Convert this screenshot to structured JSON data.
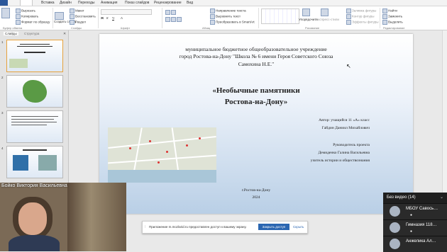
{
  "ribbon_tabs": [
    "Вставка",
    "Дизайн",
    "Переходы",
    "Анимация",
    "Показ слайдов",
    "Рецензирование",
    "Вид"
  ],
  "ribbon": {
    "cut": "Вырезать",
    "copy": "Копировать",
    "format_painter": "Формат по образцу",
    "layout": "Макет",
    "reset": "Восстановить",
    "section": "Раздел",
    "create_slide": "Создать слайд",
    "text_direction": "Направление текста",
    "align_text": "Выровнять текст",
    "smartart": "Преобразовать в SmartArt",
    "arrange": "Упорядочить",
    "quick_styles": "Экспресс-стили",
    "shape_fill": "Заливка фигуры",
    "shape_outline": "Контур фигуры",
    "shape_effects": "Эффекты фигуры",
    "find": "Найти",
    "replace": "Заменить",
    "select": "Выделить",
    "group_clipboard": "Буфер обмена",
    "group_slides": "Слайды",
    "group_font": "Шрифт",
    "group_paragraph": "Абзац",
    "group_drawing": "Рисование",
    "group_editing": "Редактирование"
  },
  "panel": {
    "tab_slides": "Слайды",
    "tab_outline": "Структура",
    "slide_numbers": [
      "1",
      "2",
      "3",
      "4"
    ]
  },
  "slide": {
    "org_line1": "муниципальное  бюджетное общеобразовательное учреждение",
    "org_line2": "город Ростова-на-Дону \"Школа  № 6 имени Героя Советского Союза",
    "org_line3": "Самохина Н.Е.\"",
    "title_line1": "«Необычные памятники",
    "title_line2": "Ростова-на-Дону»",
    "author1": "Автор: учащийся  11 «А» класс",
    "author2": "Гайдин Даниил Михайлович",
    "supervisor_label": "Руководитель проекта",
    "supervisor_name": "Демиденко Галина Васильевна",
    "supervisor_role": "учитель истории и обществознания",
    "city": "г.Ростов-на-Дону",
    "year": "2024"
  },
  "notification": {
    "text": "Приложение m.mozlarid.ru предоставлен доступ к вашему экрану.",
    "accept": "Закрыть доступ",
    "hide": "Скрыть"
  },
  "video": {
    "name": "Бойко Виктория Васильевна"
  },
  "participants": {
    "title": "Без видео (14)",
    "items": [
      {
        "name": "МБОУ Савось…"
      },
      {
        "name": "Гимназия 118…"
      },
      {
        "name": "Анжелика Ал…"
      }
    ]
  },
  "colors": {
    "accent": "#2b579a",
    "slide_bg_bottom": "#b9cfe6",
    "panel_bg": "#1f1f1f"
  }
}
